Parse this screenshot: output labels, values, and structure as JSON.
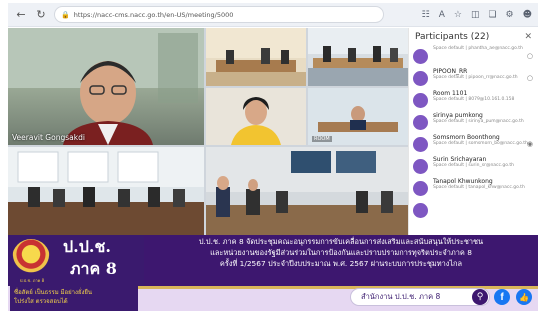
{
  "browser": {
    "url": "https://nacc-cms.nacc.go.th/en-US/meeting/5000"
  },
  "participants": {
    "title": "Participants (22)",
    "items": [
      {
        "name": "",
        "sub": "Space default | phantha_ae@nacc.go.th"
      },
      {
        "name": "PIPOON_RR",
        "sub": "Space default | pipoon_rr@nacc.go.th"
      },
      {
        "name": "Room 1101",
        "sub": "Space default | 8079@10.161.0.158"
      },
      {
        "name": "sirinya pumkong",
        "sub": "Space default | sirinya_pum@nacc.go.th"
      },
      {
        "name": "Somsmorn Boonthong",
        "sub": "Space default | somsmorn_bo@nacc.go.th"
      },
      {
        "name": "Surin Srichayaran",
        "sub": "Space default | surin_sr@nacc.go.th"
      },
      {
        "name": "Tanapol Khwunkong",
        "sub": "Space default | tanapol_khw@nacc.go.th"
      },
      {
        "name": "",
        "sub": ""
      }
    ]
  },
  "video": {
    "main_name": "Veeravit Gongsakdi"
  },
  "banner": {
    "org_line1": "ป.ป.ช.",
    "org_line2": "ภาค 8",
    "logo_caption": "ป.ป.ช. ภาค 8",
    "line1": "ป.ป.ช. ภาค 8 จัดประชุมคณะอนุกรรมการขับเคลื่อนการส่งเสริมและสนับสนุนให้ประชาชน",
    "line2": "และหน่วยงานของรัฐมีส่วนร่วมในการป้องกันและปราบปรามการทุจริตประจำภาค 8",
    "line3": "ครั้งที่ 1/2567 ประจำปีงบประมาณ พ.ศ. 2567 ผ่านระบบการประชุมทางไกล",
    "slogan_1": "ซื่อสัตย์ เป็นธรรม มีอย่างยั่งยืน",
    "slogan_2": "โปร่งใส ตรวจสอบได้",
    "office": "สำนักงาน ป.ป.ช. ภาค 8"
  },
  "colors": {
    "banner_purple": "#3d176f",
    "gold": "#d9b65a",
    "avatar_purple": "#7e57c2"
  }
}
